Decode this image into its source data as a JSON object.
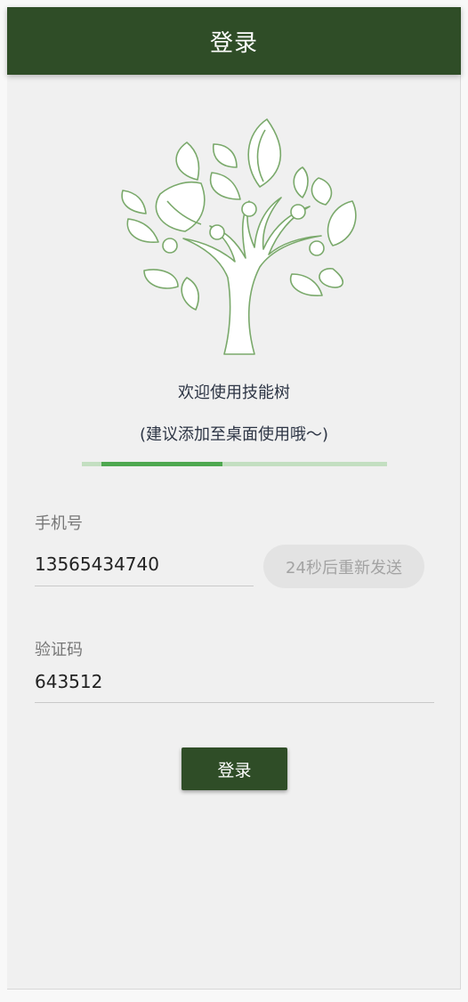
{
  "appbar": {
    "title": "登录"
  },
  "logo": {
    "icon": "skill-tree-icon",
    "stroke_color": "#7aa96b"
  },
  "welcome": {
    "line1": "欢迎使用技能树",
    "line2": "(建议添加至桌面使用哦～)"
  },
  "progress": {
    "start_fraction": 0.064,
    "fraction": 0.396
  },
  "phone": {
    "label": "手机号",
    "value": "13565434740",
    "resend_label": "24秒后重新发送"
  },
  "code": {
    "label": "验证码",
    "value": "643512"
  },
  "login_button": {
    "label": "登录"
  },
  "colors": {
    "primary": "#2f4d27",
    "progress_fill": "#4ea850",
    "progress_track": "#c3dfc1",
    "background": "#f0f0f0"
  }
}
